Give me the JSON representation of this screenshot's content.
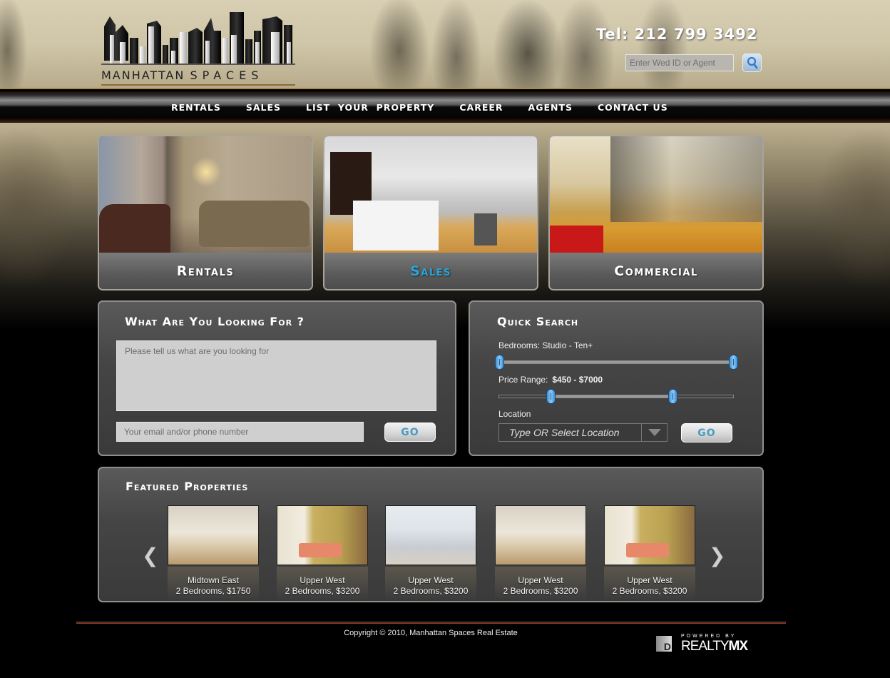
{
  "header": {
    "logo_text_a": "MANHATTAN",
    "logo_text_b": "SPACES",
    "telephone": "Tel: 212 799 3492",
    "search": {
      "placeholder": "Enter Wed ID or Agent",
      "value": ""
    },
    "search_icon": "search-icon"
  },
  "nav": {
    "items": [
      {
        "label": "RENTALS"
      },
      {
        "label": "SALES"
      },
      {
        "label": "LIST  YOUR  PROPERTY"
      },
      {
        "label": "CAREER"
      },
      {
        "label": "AGENTS"
      },
      {
        "label": "CONTACT US"
      }
    ]
  },
  "categories": [
    {
      "label": "Rentals",
      "active": false
    },
    {
      "label": "Sales",
      "active": true
    },
    {
      "label": "Commercial",
      "active": false
    }
  ],
  "inquiry": {
    "title": "What Are You Looking For ?",
    "message_placeholder": "Please tell us what are you looking for",
    "contact_placeholder": "Your email and/or phone number",
    "go_label": "GO"
  },
  "quick_search": {
    "title": "Quick Search",
    "bedrooms_label": "Bedrooms: Studio - Ten+",
    "bedrooms_range": {
      "min_fraction": 0.0,
      "max_fraction": 1.0
    },
    "price_label": "Price Range:",
    "price_value": "$450 - $7000",
    "price_range": {
      "min_fraction": 0.22,
      "max_fraction": 0.74
    },
    "location_label": "Location",
    "location_placeholder": "Type OR Select Location",
    "go_label": "GO"
  },
  "featured": {
    "title": "Featured Properties",
    "prev_icon": "chevron-left-icon",
    "next_icon": "chevron-right-icon",
    "prev_glyph": "❮",
    "next_glyph": "❯",
    "properties": [
      {
        "area": "Midtown East",
        "details": "2 Bedrooms, $1750"
      },
      {
        "area": "Upper West",
        "details": "2 Bedrooms, $3200"
      },
      {
        "area": "Upper West",
        "details": "2 Bedrooms, $3200"
      },
      {
        "area": "Upper West",
        "details": "2 Bedrooms, $3200"
      },
      {
        "area": "Upper West",
        "details": "2 Bedrooms, $3200"
      }
    ]
  },
  "footer": {
    "copyright": "Copyright © 2010, Manhattan Spaces Real Estate",
    "powered_by": "POWERED BY",
    "brand_a": "REALTY",
    "brand_b": "MX",
    "badge_letter": "D"
  }
}
